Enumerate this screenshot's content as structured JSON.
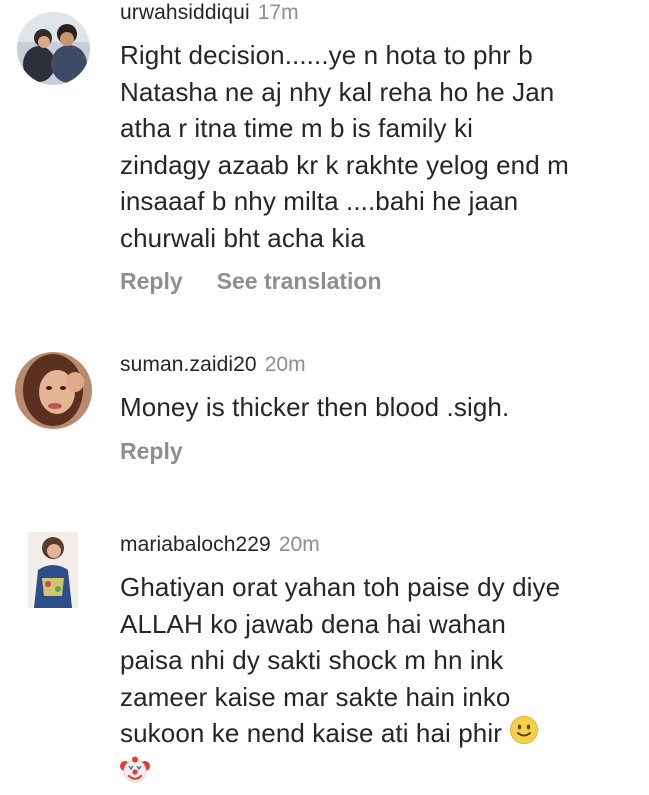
{
  "comments": [
    {
      "username": "urwahsiddiqui",
      "time": "17m",
      "lines": [
        "Right decision......ye n hota to phr b",
        "Natasha ne aj nhy kal  reha ho he Jan",
        "atha r itna time m b is family ki",
        "zindagy azaab kr k rakhte yelog end m",
        "insaaaf b nhy milta ....bahi he jaan",
        "churwali bht acha kia"
      ],
      "reply_label": "Reply",
      "translate_label": "See translation"
    },
    {
      "username": "suman.zaidi20",
      "time": "20m",
      "lines": [
        "Money is thicker then blood .sigh."
      ],
      "reply_label": "Reply"
    },
    {
      "username": "mariabaloch229",
      "time": "20m",
      "lines": [
        "Ghatiyan orat yahan toh paise dy diye",
        "ALLAH ko jawab dena hai wahan",
        "paisa nhi dy sakti shock m hn ink",
        "zameer kaise mar sakte hain inko",
        "sukoon ke nend kaise ati hai phir"
      ],
      "emojis": [
        "slightly-smiling-face",
        "clown-face"
      ]
    }
  ],
  "colors": {
    "text": "#262626",
    "secondary": "#8e8e8e",
    "background": "#ffffff"
  }
}
